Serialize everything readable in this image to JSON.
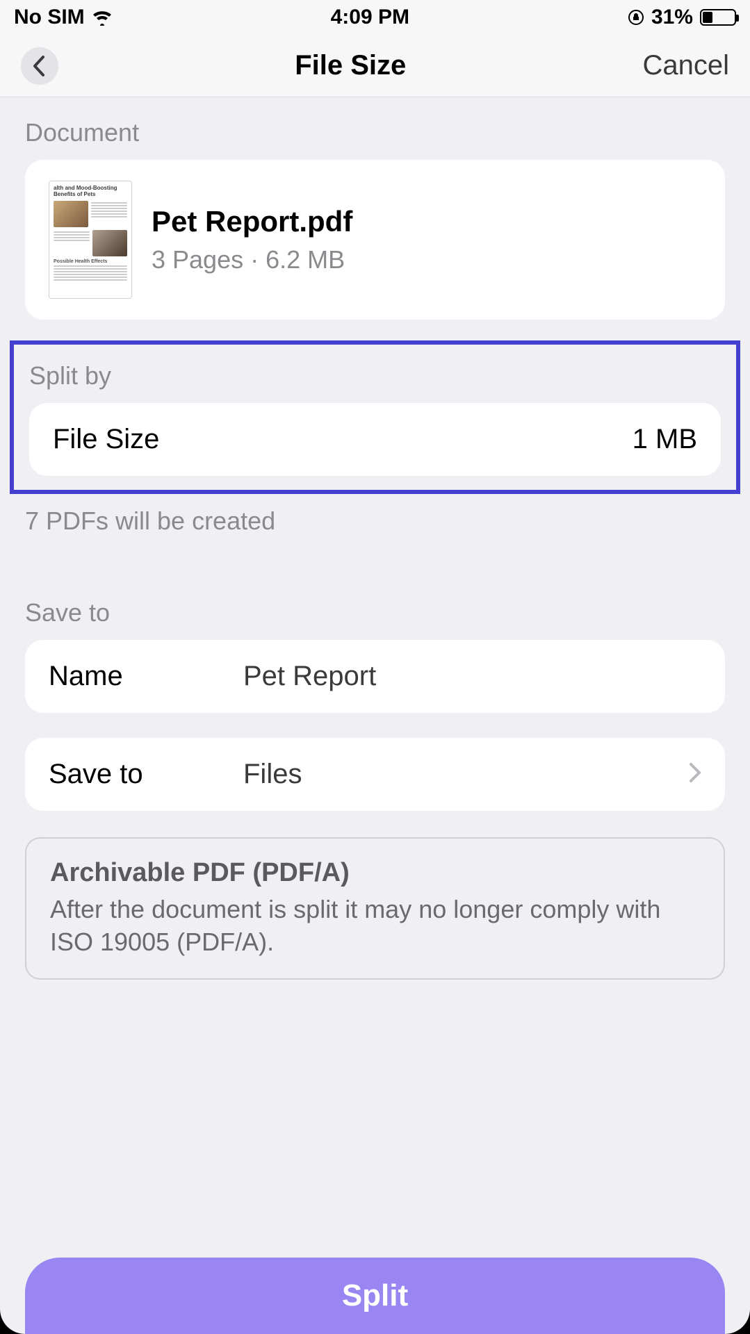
{
  "status": {
    "carrier": "No SIM",
    "time": "4:09 PM",
    "battery_pct": "31%"
  },
  "nav": {
    "title": "File Size",
    "cancel": "Cancel"
  },
  "document": {
    "section_label": "Document",
    "filename": "Pet Report.pdf",
    "subtitle": "3 Pages · 6.2 MB",
    "thumb_heading": "alth and Mood-Boosting Benefits of Pets",
    "thumb_sub": "Possible Health Effects"
  },
  "split_by": {
    "section_label": "Split by",
    "method_label": "File Size",
    "method_value": "1 MB",
    "result_hint": "7 PDFs will be created"
  },
  "save_to": {
    "section_label": "Save to",
    "name_label": "Name",
    "name_value": "Pet Report",
    "dest_label": "Save to",
    "dest_value": "Files"
  },
  "info": {
    "title": "Archivable PDF (PDF/A)",
    "body": "After the document is split it may no longer comply with ISO 19005 (PDF/A)."
  },
  "action": {
    "split": "Split"
  }
}
